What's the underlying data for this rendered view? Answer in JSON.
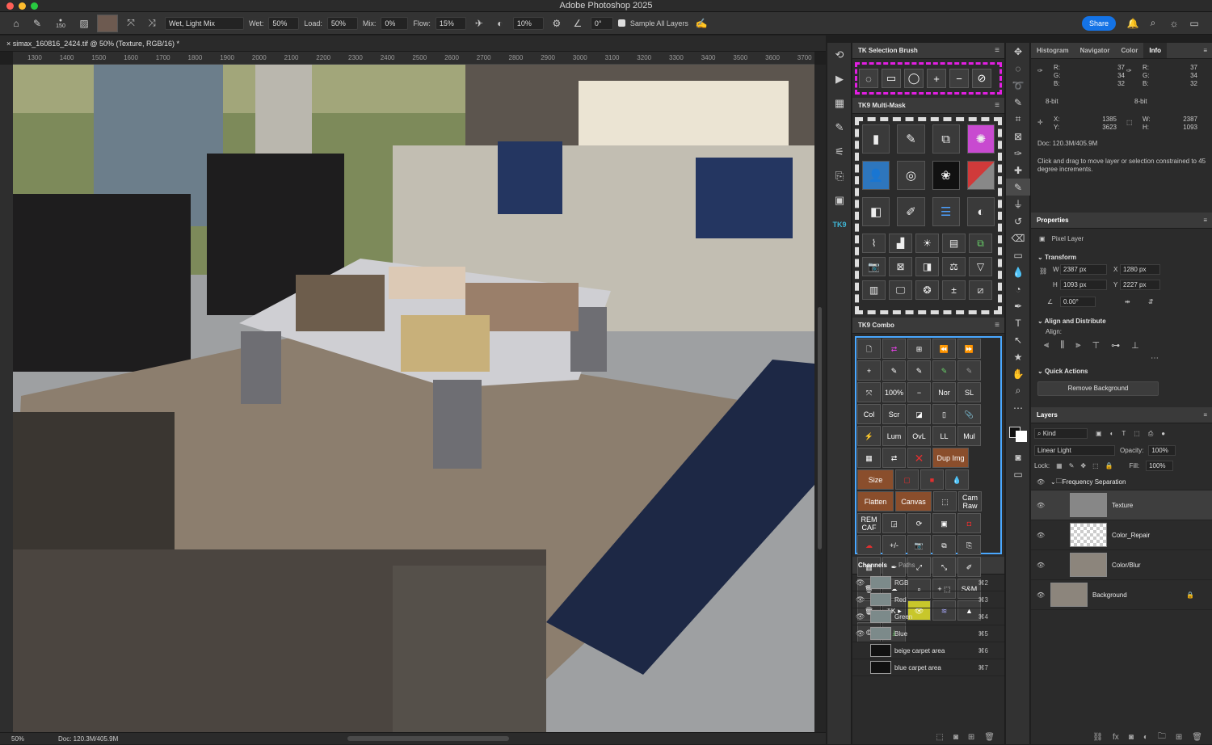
{
  "window": {
    "title": "Adobe Photoshop 2025"
  },
  "options_bar": {
    "brush_size": "150",
    "preset": "Wet, Light Mix",
    "wet_label": "Wet:",
    "wet": "50%",
    "load_label": "Load:",
    "load": "50%",
    "mix_label": "Mix:",
    "mix": "0%",
    "flow_label": "Flow:",
    "flow": "15%",
    "smoothing": "10%",
    "angle": "0°",
    "sample_all_layers": "Sample All Layers",
    "share": "Share"
  },
  "document": {
    "tab_title": "simax_160816_2424.tif @ 50% (Texture, RGB/16) *",
    "zoom": "50%",
    "doc_size": "Doc: 120.3M/405.9M"
  },
  "ruler": {
    "h_ticks": [
      "1300",
      "1400",
      "1500",
      "1600",
      "1700",
      "1800",
      "1900",
      "2000",
      "2100",
      "2200",
      "2300",
      "2400",
      "2500",
      "2600",
      "2700",
      "2800",
      "2900",
      "3000",
      "3100",
      "3200",
      "3300",
      "3400",
      "3500",
      "3600",
      "3700"
    ]
  },
  "tk_selection_brush": {
    "title": "TK Selection Brush",
    "icons": [
      "circle-selection",
      "rect-selection",
      "ellipse-selection",
      "add",
      "subtract",
      "clear"
    ]
  },
  "tk9_multimask": {
    "title": "TK9 Multi-Mask"
  },
  "tk9_combo": {
    "title": "TK9 Combo",
    "text_buttons": [
      "100%",
      "Nor",
      "SL",
      "Col",
      "Scr",
      "Lum",
      "OvL",
      "LL",
      "Mul",
      "Dup Img",
      "Size",
      "Flatten",
      "Canvas",
      "Cam Raw",
      "REM CAF",
      "+/-",
      "± ⬚",
      "S&M",
      "TK ▸"
    ]
  },
  "channels": {
    "tabs": [
      "Channels",
      "Paths"
    ],
    "rows": [
      {
        "name": "RGB",
        "shortcut": "⌘2"
      },
      {
        "name": "Red",
        "shortcut": "⌘3"
      },
      {
        "name": "Green",
        "shortcut": "⌘4"
      },
      {
        "name": "Blue",
        "shortcut": "⌘5"
      },
      {
        "name": "beige carpet area",
        "shortcut": "⌘6"
      },
      {
        "name": "blue carpet area",
        "shortcut": "⌘7"
      }
    ]
  },
  "right_tabs": [
    "Histogram",
    "Navigator",
    "Color",
    "Info"
  ],
  "info": {
    "r1": "37",
    "g1": "34",
    "b1": "32",
    "r2": "37",
    "g2": "34",
    "b2": "32",
    "bit1": "8-bit",
    "bit2": "8-bit",
    "x": "1385",
    "y": "3623",
    "w": "2387",
    "h": "1093",
    "doc": "Doc: 120.3M/405.9M",
    "hint": "Click and drag to move layer or selection constrained to 45 degree increments."
  },
  "properties": {
    "title": "Properties",
    "pixel_layer": "Pixel Layer",
    "transform": "Transform",
    "w": "2387 px",
    "x": "1280 px",
    "h": "1093 px",
    "y": "2227 px",
    "angle": "0.00°",
    "align": "Align and Distribute",
    "align_label": "Align:",
    "quick_actions": "Quick Actions",
    "remove_bg": "Remove Background"
  },
  "layers": {
    "title": "Layers",
    "kind": "Kind",
    "blend": "Linear Light",
    "opacity_label": "Opacity:",
    "opacity": "100%",
    "lock_label": "Lock:",
    "fill_label": "Fill:",
    "fill": "100%",
    "group": "Frequency Separation",
    "items": [
      "Texture",
      "Color_Repair",
      "Color/Blur",
      "Background"
    ]
  }
}
